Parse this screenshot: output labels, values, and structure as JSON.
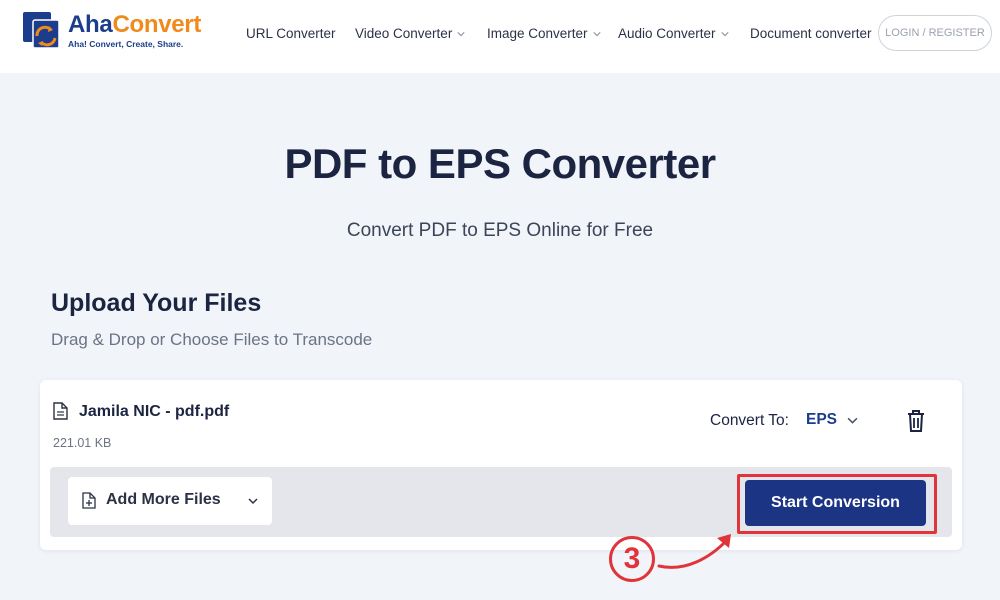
{
  "brand": {
    "name_part1": "Aha",
    "name_part2": "Convert",
    "tagline": "Aha! Convert, Create, Share.",
    "primary_color": "#1c3d8c",
    "accent_color": "#f08a1c"
  },
  "nav": {
    "items": [
      {
        "label": "URL Converter",
        "has_dropdown": false
      },
      {
        "label": "Video Converter",
        "has_dropdown": true
      },
      {
        "label": "Image Converter",
        "has_dropdown": true
      },
      {
        "label": "Audio Converter",
        "has_dropdown": true
      },
      {
        "label": "Document converter",
        "has_dropdown": false
      }
    ],
    "login_label": "LOGIN / REGISTER"
  },
  "hero": {
    "title": "PDF to EPS Converter",
    "subtitle": "Convert PDF to EPS Online for Free"
  },
  "upload": {
    "title": "Upload Your Files",
    "subtitle": "Drag & Drop or Choose Files to Transcode"
  },
  "file": {
    "name": "Jamila NIC - pdf.pdf",
    "size": "221.01 KB",
    "convert_to_label": "Convert To:",
    "format": "EPS"
  },
  "actions": {
    "add_more_label": "Add More Files",
    "start_label": "Start Conversion",
    "button_color": "#1c3484"
  },
  "annotation": {
    "step_number": "3",
    "color": "#e0333a"
  }
}
